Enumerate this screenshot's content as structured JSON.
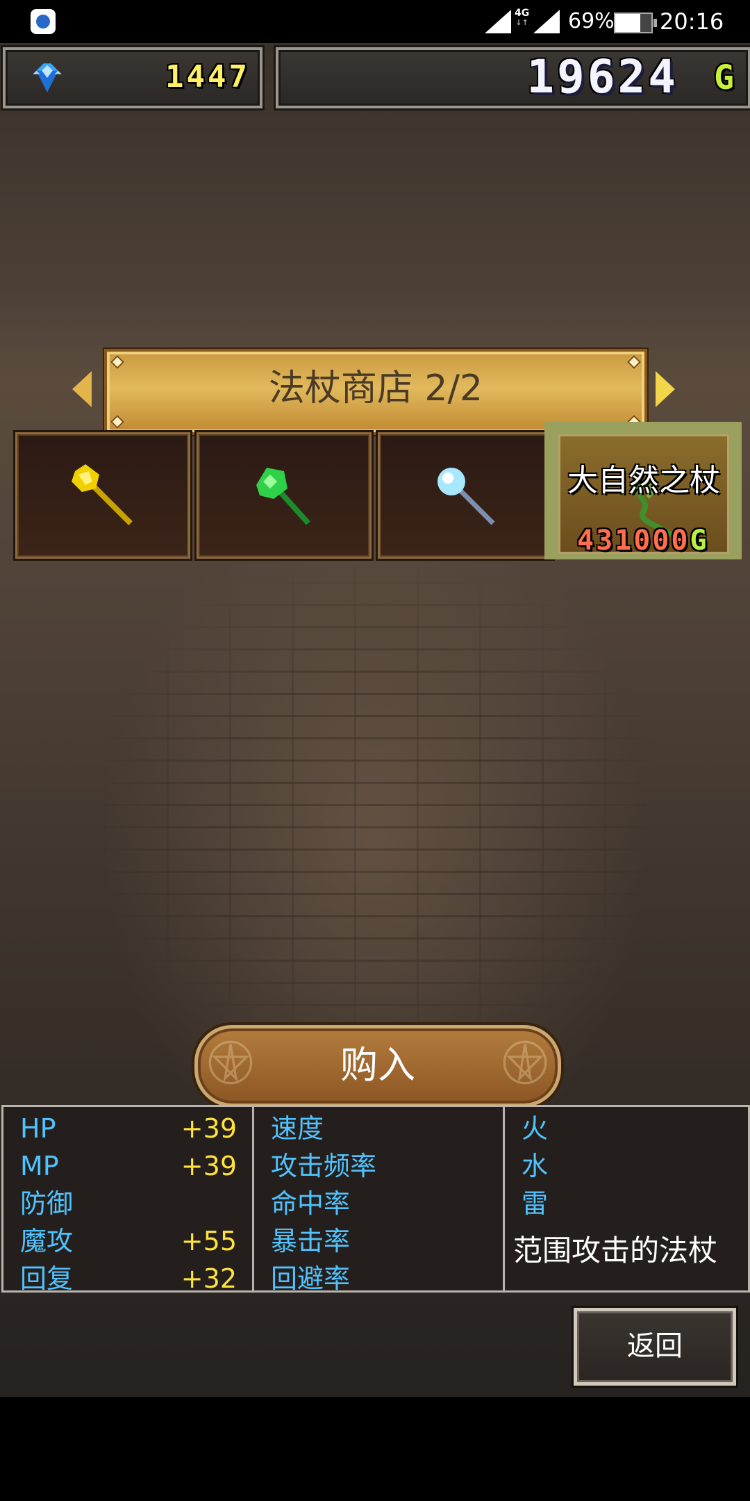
{
  "status_bar": {
    "network": "4G",
    "battery": "69%",
    "time": "20:16"
  },
  "currency": {
    "gems": "1447",
    "gold": "19624",
    "gold_unit": "G"
  },
  "shop": {
    "title": "法杖商店  2/2"
  },
  "items": [
    {
      "icon": "golden-staff-icon",
      "color": "#f0d000"
    },
    {
      "icon": "emerald-staff-icon",
      "color": "#2fd14a"
    },
    {
      "icon": "crystal-staff-icon",
      "color": "#a8e8ff"
    },
    {
      "icon": "nature-staff-icon",
      "color": "#3f8f2a"
    }
  ],
  "selected": {
    "name": "大自然之杖",
    "price": "431000",
    "price_unit": "G"
  },
  "buy_label": "购入",
  "stats": {
    "col1": [
      {
        "name": "HP",
        "value": "+39"
      },
      {
        "name": "MP",
        "value": "+39"
      },
      {
        "name": "防御",
        "value": ""
      },
      {
        "name": "魔攻",
        "value": "+55"
      },
      {
        "name": "回复",
        "value": "+32"
      }
    ],
    "col2": [
      {
        "name": "速度",
        "value": ""
      },
      {
        "name": "攻击频率",
        "value": ""
      },
      {
        "name": "命中率",
        "value": ""
      },
      {
        "name": "暴击率",
        "value": ""
      },
      {
        "name": "回避率",
        "value": ""
      }
    ],
    "col3": [
      {
        "name": "火",
        "value": ""
      },
      {
        "name": "水",
        "value": ""
      },
      {
        "name": "雷",
        "value": ""
      }
    ],
    "description": "范围攻击的法杖"
  },
  "back_label": "返回"
}
